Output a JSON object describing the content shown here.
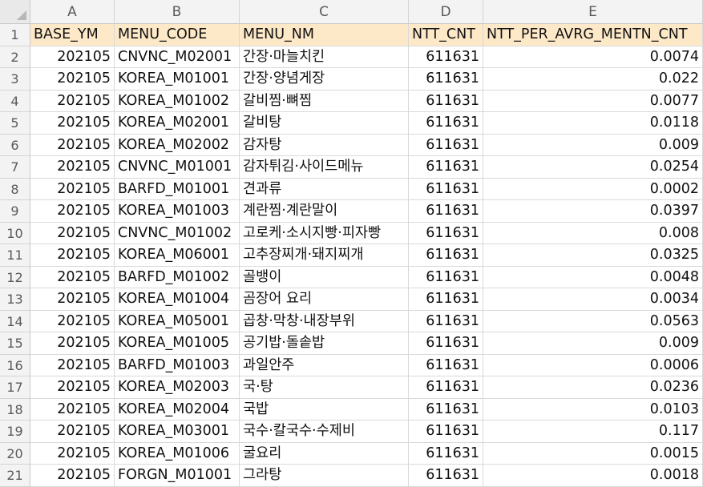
{
  "columns": [
    "A",
    "B",
    "C",
    "D",
    "E"
  ],
  "header_row": [
    "BASE_YM",
    "MENU_CODE",
    "MENU_NM",
    "NTT_CNT",
    "NTT_PER_AVRG_MENTN_CNT"
  ],
  "rows": [
    [
      "202105",
      "CNVNC_M02001",
      "간장·마늘치킨",
      "611631",
      "0.0074"
    ],
    [
      "202105",
      "KOREA_M01001",
      "간장·양념게장",
      "611631",
      "0.022"
    ],
    [
      "202105",
      "KOREA_M01002",
      "갈비찜·뼈찜",
      "611631",
      "0.0077"
    ],
    [
      "202105",
      "KOREA_M02001",
      "갈비탕",
      "611631",
      "0.0118"
    ],
    [
      "202105",
      "KOREA_M02002",
      "감자탕",
      "611631",
      "0.009"
    ],
    [
      "202105",
      "CNVNC_M01001",
      "감자튀김·사이드메뉴",
      "611631",
      "0.0254"
    ],
    [
      "202105",
      "BARFD_M01001",
      "견과류",
      "611631",
      "0.0002"
    ],
    [
      "202105",
      "KOREA_M01003",
      "계란찜·계란말이",
      "611631",
      "0.0397"
    ],
    [
      "202105",
      "CNVNC_M01002",
      "고로케·소시지빵·피자빵",
      "611631",
      "0.008"
    ],
    [
      "202105",
      "KOREA_M06001",
      "고추장찌개·돼지찌개",
      "611631",
      "0.0325"
    ],
    [
      "202105",
      "BARFD_M01002",
      "골뱅이",
      "611631",
      "0.0048"
    ],
    [
      "202105",
      "KOREA_M01004",
      "곰장어 요리",
      "611631",
      "0.0034"
    ],
    [
      "202105",
      "KOREA_M05001",
      "곱창·막창·내장부위",
      "611631",
      "0.0563"
    ],
    [
      "202105",
      "KOREA_M01005",
      "공기밥·돌솥밥",
      "611631",
      "0.009"
    ],
    [
      "202105",
      "BARFD_M01003",
      "과일안주",
      "611631",
      "0.0006"
    ],
    [
      "202105",
      "KOREA_M02003",
      "국·탕",
      "611631",
      "0.0236"
    ],
    [
      "202105",
      "KOREA_M02004",
      "국밥",
      "611631",
      "0.0103"
    ],
    [
      "202105",
      "KOREA_M03001",
      "국수·칼국수·수제비",
      "611631",
      "0.117"
    ],
    [
      "202105",
      "KOREA_M01006",
      "굴요리",
      "611631",
      "0.0015"
    ],
    [
      "202105",
      "FORGN_M01001",
      "그라탕",
      "611631",
      "0.0018"
    ]
  ],
  "colors": {
    "header_fill": "#fde9c8",
    "grid_line": "#d9d9d9",
    "heading_bg": "#f3f3f3"
  }
}
